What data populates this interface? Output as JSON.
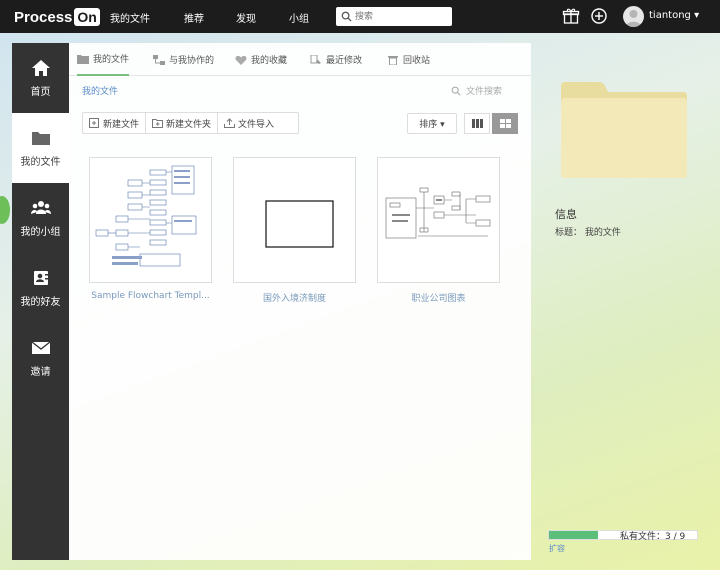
{
  "app": {
    "logo_text": "Process",
    "logo_badge": "On"
  },
  "topnav": {
    "items": [
      "我的文件",
      "推荐",
      "发现",
      "小组"
    ],
    "search_placeholder": "搜索",
    "username": "tiantong ▾"
  },
  "sidebar": {
    "items": [
      {
        "label": "首页",
        "icon": "home-icon"
      },
      {
        "label": "我的文件",
        "icon": "folder-icon"
      },
      {
        "label": "我的小组",
        "icon": "group-icon"
      },
      {
        "label": "我的好友",
        "icon": "contact-card-icon"
      },
      {
        "label": "邀请",
        "icon": "envelope-icon"
      }
    ],
    "active_index": 1
  },
  "tabs": [
    {
      "label": "我的文件",
      "icon": "folder-icon"
    },
    {
      "label": "与我协作的",
      "icon": "collab-icon"
    },
    {
      "label": "我的收藏",
      "icon": "heart-icon"
    },
    {
      "label": "最近修改",
      "icon": "recent-icon"
    },
    {
      "label": "回收站",
      "icon": "trash-icon"
    }
  ],
  "breadcrumb": "我的文件",
  "file_search_placeholder": "文件搜索",
  "toolbar": {
    "new_file": "新建文件",
    "new_folder": "新建文件夹",
    "import": "文件导入",
    "sort": "排序 ▾"
  },
  "files": [
    {
      "title": "Sample Flowchart Templ..."
    },
    {
      "title": "国外入境济制度"
    },
    {
      "title": "职业公司图表"
    }
  ],
  "info": {
    "heading": "信息",
    "title_label": "标题：",
    "title_value": "我的文件"
  },
  "quota": {
    "label": "私有文件：3 / 9",
    "used": 3,
    "total": 9,
    "expand": "扩容"
  },
  "colors": {
    "accent": "#5bbf7a",
    "topbar": "#1c1c1c",
    "sidebar": "#333333"
  }
}
